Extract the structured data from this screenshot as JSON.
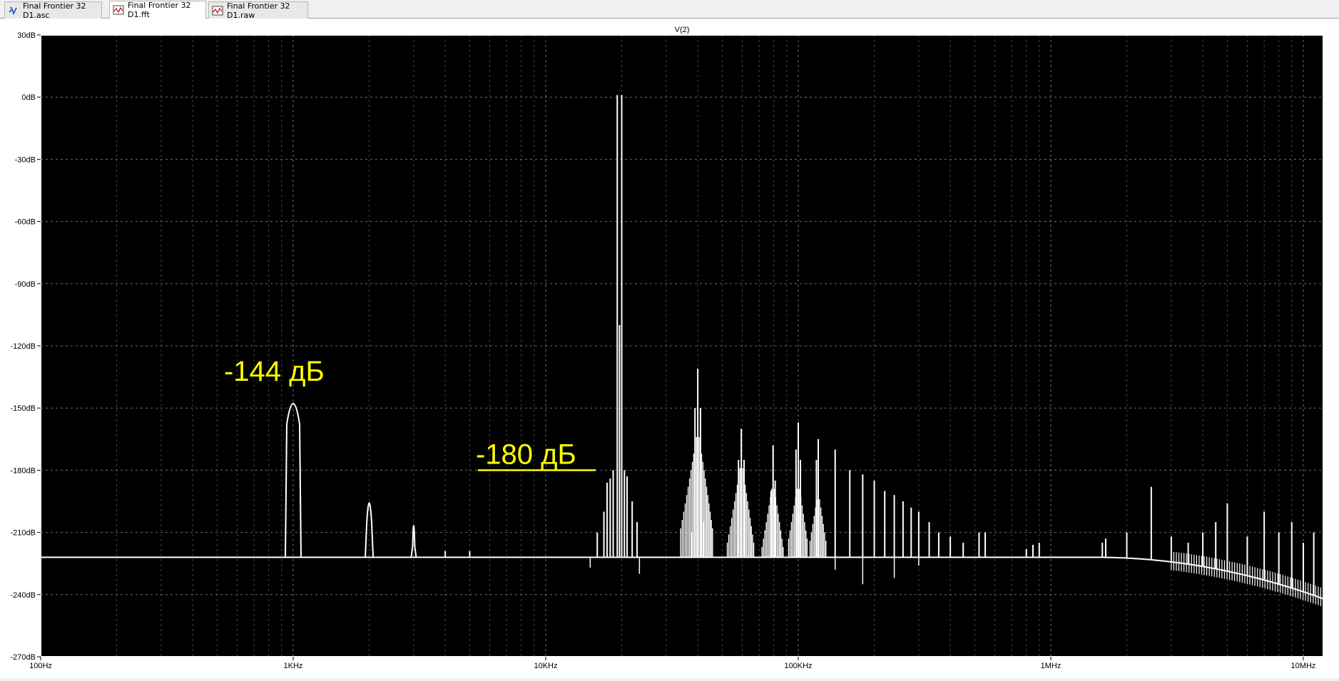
{
  "tabs": [
    {
      "label": "Final Frontier 32 D1.asc",
      "icon": "schematic-icon",
      "active": false
    },
    {
      "label": "Final Frontier 32 D1.fft",
      "icon": "waveform-icon",
      "active": true
    },
    {
      "label": "Final Frontier 32 D1.raw",
      "icon": "waveform-icon",
      "active": false
    }
  ],
  "colors": {
    "background": "#000000",
    "grid": "#808080",
    "trace": "#ffffff",
    "annotation": "#ffff00",
    "frame": "#ffffff"
  },
  "chart_data": {
    "type": "line",
    "title": "V(2)",
    "xlabel": "",
    "ylabel": "",
    "xscale": "log",
    "xlim": [
      100,
      12000000
    ],
    "ylim": [
      -270,
      30
    ],
    "grid": true,
    "x_ticks": [
      "100Hz",
      "1KHz",
      "10KHz",
      "100KHz",
      "1MHz",
      "10MHz"
    ],
    "y_ticks": [
      "30dB",
      "0dB",
      "-30dB",
      "-60dB",
      "-90dB",
      "-120dB",
      "-150dB",
      "-180dB",
      "-210dB",
      "-240dB",
      "-270dB"
    ],
    "noise_floor_db": -222,
    "hf_rolloff_db_at_12MHz": -242,
    "peaks": [
      {
        "x": 1000,
        "y": -144
      },
      {
        "x": 2000,
        "y": -192
      },
      {
        "x": 3000,
        "y": -203
      },
      {
        "x": 4000,
        "y": -219
      },
      {
        "x": 5000,
        "y": -219
      },
      {
        "x": 16000,
        "y": -210
      },
      {
        "x": 17000,
        "y": -200
      },
      {
        "x": 17500,
        "y": -186
      },
      {
        "x": 18000,
        "y": -184
      },
      {
        "x": 18500,
        "y": -180
      },
      {
        "x": 19200,
        "y": 1
      },
      {
        "x": 19600,
        "y": -110
      },
      {
        "x": 20000,
        "y": 1
      },
      {
        "x": 20500,
        "y": -180
      },
      {
        "x": 21000,
        "y": -183
      },
      {
        "x": 22000,
        "y": -195
      },
      {
        "x": 23000,
        "y": -205
      },
      {
        "x": 38000,
        "y": -210
      },
      {
        "x": 39000,
        "y": -150
      },
      {
        "x": 40000,
        "y": -131
      },
      {
        "x": 41000,
        "y": -150
      },
      {
        "x": 42000,
        "y": -205
      },
      {
        "x": 58000,
        "y": -175
      },
      {
        "x": 59500,
        "y": -160
      },
      {
        "x": 61000,
        "y": -175
      },
      {
        "x": 78000,
        "y": -190
      },
      {
        "x": 79500,
        "y": -168
      },
      {
        "x": 81000,
        "y": -185
      },
      {
        "x": 98000,
        "y": -170
      },
      {
        "x": 100000,
        "y": -157
      },
      {
        "x": 102000,
        "y": -175
      },
      {
        "x": 118000,
        "y": -175
      },
      {
        "x": 120000,
        "y": -165
      },
      {
        "x": 140000,
        "y": -170
      },
      {
        "x": 160000,
        "y": -180
      },
      {
        "x": 180000,
        "y": -182
      },
      {
        "x": 200000,
        "y": -185
      },
      {
        "x": 220000,
        "y": -190
      },
      {
        "x": 240000,
        "y": -192
      },
      {
        "x": 260000,
        "y": -195
      },
      {
        "x": 280000,
        "y": -198
      },
      {
        "x": 300000,
        "y": -200
      },
      {
        "x": 330000,
        "y": -205
      },
      {
        "x": 360000,
        "y": -210
      },
      {
        "x": 400000,
        "y": -212
      },
      {
        "x": 450000,
        "y": -215
      },
      {
        "x": 520000,
        "y": -210
      },
      {
        "x": 550000,
        "y": -210
      },
      {
        "x": 800000,
        "y": -218
      },
      {
        "x": 850000,
        "y": -216
      },
      {
        "x": 900000,
        "y": -215
      },
      {
        "x": 1600000,
        "y": -215
      },
      {
        "x": 1650000,
        "y": -213
      },
      {
        "x": 2000000,
        "y": -210
      },
      {
        "x": 2500000,
        "y": -188
      },
      {
        "x": 3000000,
        "y": -212
      },
      {
        "x": 3500000,
        "y": -215
      },
      {
        "x": 4000000,
        "y": -210
      },
      {
        "x": 4500000,
        "y": -205
      },
      {
        "x": 5000000,
        "y": -196
      },
      {
        "x": 6000000,
        "y": -212
      },
      {
        "x": 7000000,
        "y": -200
      },
      {
        "x": 8000000,
        "y": -210
      },
      {
        "x": 9000000,
        "y": -205
      },
      {
        "x": 10000000,
        "y": -215
      },
      {
        "x": 11000000,
        "y": -210
      }
    ],
    "dips": [
      {
        "x": 15000,
        "y": -227
      },
      {
        "x": 23500,
        "y": -230
      },
      {
        "x": 140000,
        "y": -228
      },
      {
        "x": 180000,
        "y": -235
      },
      {
        "x": 240000,
        "y": -232
      },
      {
        "x": 300000,
        "y": -226
      }
    ],
    "annotations": [
      {
        "text": "-144 дБ",
        "x": 1000,
        "y": -144
      },
      {
        "text": "-180 дБ",
        "x": 10000,
        "y": -180
      }
    ]
  }
}
